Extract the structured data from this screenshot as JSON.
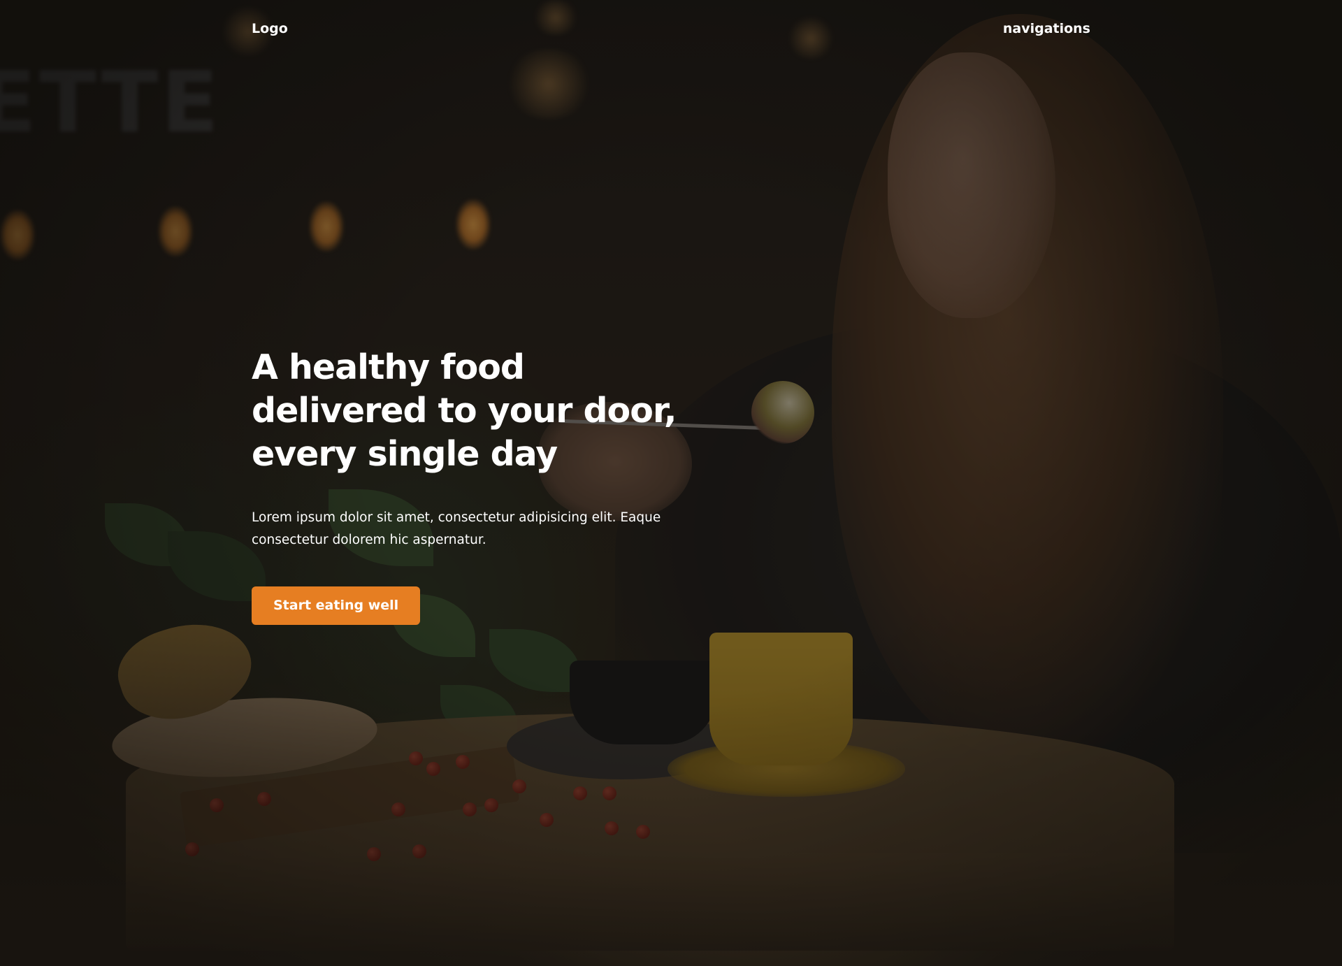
{
  "header": {
    "logo": "Logo",
    "nav_label": "navigations"
  },
  "hero": {
    "headline_lines": [
      "A healthy food",
      "delivered to your door,",
      "every single day"
    ],
    "description": "Lorem ipsum dolor sit amet, consectetur adipisicing elit. Eaque consectetur dolorem hic aspernatur.",
    "cta_label": "Start eating well"
  },
  "colors": {
    "accent": "#e67e22",
    "text": "#ffffff",
    "overlay": "#0c0a08"
  },
  "background_image": "woman-eating-at-restaurant-photo"
}
